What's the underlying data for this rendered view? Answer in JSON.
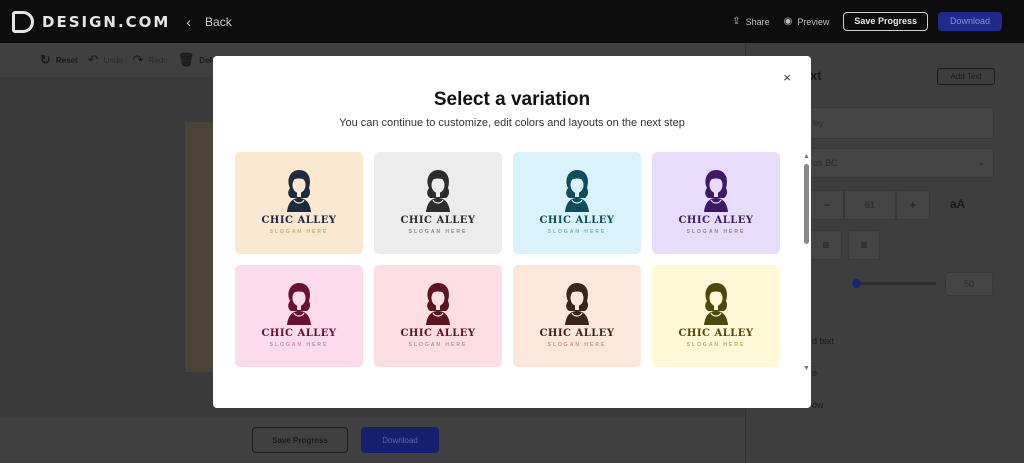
{
  "header": {
    "logo_text": "DESIGN.COM",
    "back_label": "Back",
    "share_label": "Share",
    "preview_label": "Preview",
    "save_progress_label": "Save Progress",
    "download_label": "Download"
  },
  "toolbar": {
    "reset_label": "Reset",
    "undo_label": "Undo",
    "redo_label": "Redo",
    "delete_label": "Dele"
  },
  "bottom_bar": {
    "save_progress_label": "Save Progress",
    "download_label": "Download"
  },
  "right_panel": {
    "title": "xt",
    "add_text_label": "Add Text",
    "text_value": "ley",
    "font_name": "us BC",
    "font_size_minus": "−",
    "font_size_value": "61",
    "font_size_plus": "+",
    "case_label": "aA",
    "slider_value": "50",
    "option_1": "d text",
    "option_2": "e",
    "option_3": "ow"
  },
  "modal": {
    "title": "Select a variation",
    "subtitle": "You can continue to customize, edit colors and layouts on the next step",
    "close_glyph": "×",
    "variations": [
      {
        "brand": "CHIC ALLEY",
        "slogan": "SLOGAN HERE",
        "bg": "#fbe8d1",
        "accent": "#1e2a40",
        "slogan_color": "#c9a878"
      },
      {
        "brand": "CHIC ALLEY",
        "slogan": "SLOGAN HERE",
        "bg": "#ececec",
        "accent": "#2c2c2c",
        "slogan_color": "#8a8a8a"
      },
      {
        "brand": "CHIC ALLEY",
        "slogan": "SLOGAN HERE",
        "bg": "#d9f2fb",
        "accent": "#0f4c5c",
        "slogan_color": "#7ab0c0"
      },
      {
        "brand": "CHIC ALLEY",
        "slogan": "SLOGAN HERE",
        "bg": "#e8dcfb",
        "accent": "#3d1a66",
        "slogan_color": "#8f78b8"
      },
      {
        "brand": "CHIC ALLEY",
        "slogan": "SLOGAN HERE",
        "bg": "#fbdbec",
        "accent": "#6a1032",
        "slogan_color": "#c98aa6"
      },
      {
        "brand": "CHIC ALLEY",
        "slogan": "SLOGAN HERE",
        "bg": "#fddfe3",
        "accent": "#5c1420",
        "slogan_color": "#c98a94"
      },
      {
        "brand": "CHIC ALLEY",
        "slogan": "SLOGAN HERE",
        "bg": "#fde6da",
        "accent": "#3a2418",
        "slogan_color": "#c59a7e"
      },
      {
        "brand": "CHIC ALLEY",
        "slogan": "SLOGAN HERE",
        "bg": "#fdf8d6",
        "accent": "#4a4a0c",
        "slogan_color": "#b7ad6a"
      }
    ]
  },
  "icons": {
    "share": "share-icon",
    "preview": "eye-icon",
    "reset": "reset-icon",
    "undo": "undo-icon",
    "redo": "redo-icon",
    "delete": "trash-icon",
    "close": "close-icon"
  },
  "colors": {
    "header_bg": "#0d0d0d",
    "download_blue": "#1f2a8c",
    "modal_bg": "#ffffff"
  }
}
